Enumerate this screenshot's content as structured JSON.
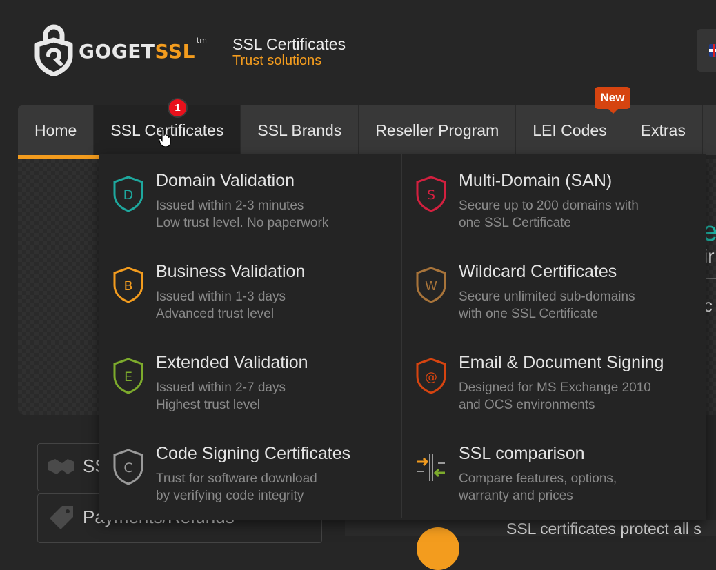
{
  "header": {
    "logo_text_1": "GOGET",
    "logo_text_2": "SSL",
    "logo_tm": "tm",
    "tagline_title": "SSL Certificates",
    "tagline_subtitle": "Trust solutions"
  },
  "nav": {
    "items": [
      {
        "label": "Home"
      },
      {
        "label": "SSL Certificates"
      },
      {
        "label": "SSL Brands"
      },
      {
        "label": "Reseller Program"
      },
      {
        "label": "LEI Codes"
      },
      {
        "label": "Extras"
      }
    ],
    "notification_count": "1",
    "new_badge": "New",
    "active_index": 1
  },
  "dropdown": {
    "items": [
      {
        "title": "Domain Validation",
        "desc1": "Issued within 2-3 minutes",
        "desc2": "Low trust level. No paperwork",
        "icon": "shield-d-icon",
        "letter": "D",
        "color": "#1ea89e"
      },
      {
        "title": "Multi-Domain (SAN)",
        "desc1": "Secure up to 200 domains with",
        "desc2": "one SSL Certificate",
        "icon": "shield-s-icon",
        "letter": "S",
        "color": "#d3203f"
      },
      {
        "title": "Business Validation",
        "desc1": "Issued within 1-3 days",
        "desc2": "Advanced trust level",
        "icon": "shield-b-icon",
        "letter": "B",
        "color": "#f39c1e"
      },
      {
        "title": "Wildcard Certificates",
        "desc1": "Secure unlimited sub-domains",
        "desc2": "with one SSL Certificate",
        "icon": "shield-w-icon",
        "letter": "W",
        "color": "#a8743a"
      },
      {
        "title": "Extended Validation",
        "desc1": "Issued within 2-7 days",
        "desc2": "Highest trust level",
        "icon": "shield-e-icon",
        "letter": "E",
        "color": "#7dab2c"
      },
      {
        "title": "Email & Document Signing",
        "desc1": "Designed for MS Exchange 2010",
        "desc2": "and OCS environments",
        "icon": "shield-at-icon",
        "letter": "@",
        "color": "#d64410"
      },
      {
        "title": "Code Signing Certificates",
        "desc1": "Trust for software download",
        "desc2": "by verifying code integrity",
        "icon": "shield-c-icon",
        "letter": "C",
        "color": "#9a9a9a"
      },
      {
        "title": "SSL comparison",
        "desc1": "Compare features, options,",
        "desc2": "warranty and prices",
        "icon": "compare-arrows-icon",
        "letter": "",
        "color": "#f39c1e"
      }
    ]
  },
  "background": {
    "side_label_1": "SS",
    "side_label_2": "Payments/Refunds",
    "hero_peek_1": "e",
    "hero_peek_2": "ir",
    "hero_peek_3": "c",
    "content_text": "SSL certificates protect all s"
  },
  "colors": {
    "accent": "#f39c1e",
    "badge_red": "#e8111c",
    "badge_new": "#d64410"
  }
}
